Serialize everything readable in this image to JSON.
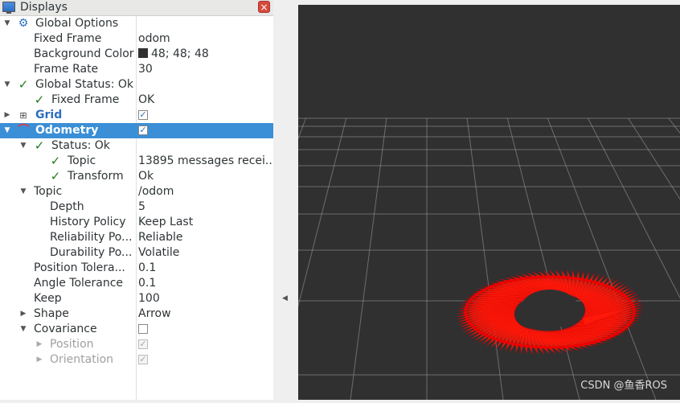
{
  "panel": {
    "title": "Displays",
    "close_label": "×"
  },
  "tree": [
    {
      "label": "Global Options",
      "value": ""
    },
    {
      "label": "Fixed Frame",
      "value": "odom"
    },
    {
      "label": "Background Color",
      "value": "48; 48; 48"
    },
    {
      "label": "Frame Rate",
      "value": "30"
    },
    {
      "label": "Global Status: Ok",
      "value": ""
    },
    {
      "label": "Fixed Frame",
      "value": "OK"
    },
    {
      "label": "Grid",
      "value": ""
    },
    {
      "label": "Odometry",
      "value": ""
    },
    {
      "label": "Status: Ok",
      "value": ""
    },
    {
      "label": "Topic",
      "value": "13895 messages recei..."
    },
    {
      "label": "Transform",
      "value": "Ok"
    },
    {
      "label": "Topic",
      "value": "/odom"
    },
    {
      "label": "Depth",
      "value": "5"
    },
    {
      "label": "History Policy",
      "value": "Keep Last"
    },
    {
      "label": "Reliability Po...",
      "value": "Reliable"
    },
    {
      "label": "Durability Po...",
      "value": "Volatile"
    },
    {
      "label": "Position Tolera...",
      "value": "0.1"
    },
    {
      "label": "Angle Tolerance",
      "value": "0.1"
    },
    {
      "label": "Keep",
      "value": "100"
    },
    {
      "label": "Shape",
      "value": "Arrow"
    },
    {
      "label": "Covariance",
      "value": ""
    },
    {
      "label": "Position",
      "value": ""
    },
    {
      "label": "Orientation",
      "value": ""
    }
  ],
  "checkboxes": {
    "grid": true,
    "odometry": true,
    "covariance": false,
    "position": true,
    "orientation": true
  },
  "colors": {
    "background": "#303030",
    "arrows": "#ff1a0a",
    "selection": "#3a8fd6",
    "grid_lines": "#a0a0a0"
  },
  "watermark": "CSDN @鱼香ROS"
}
